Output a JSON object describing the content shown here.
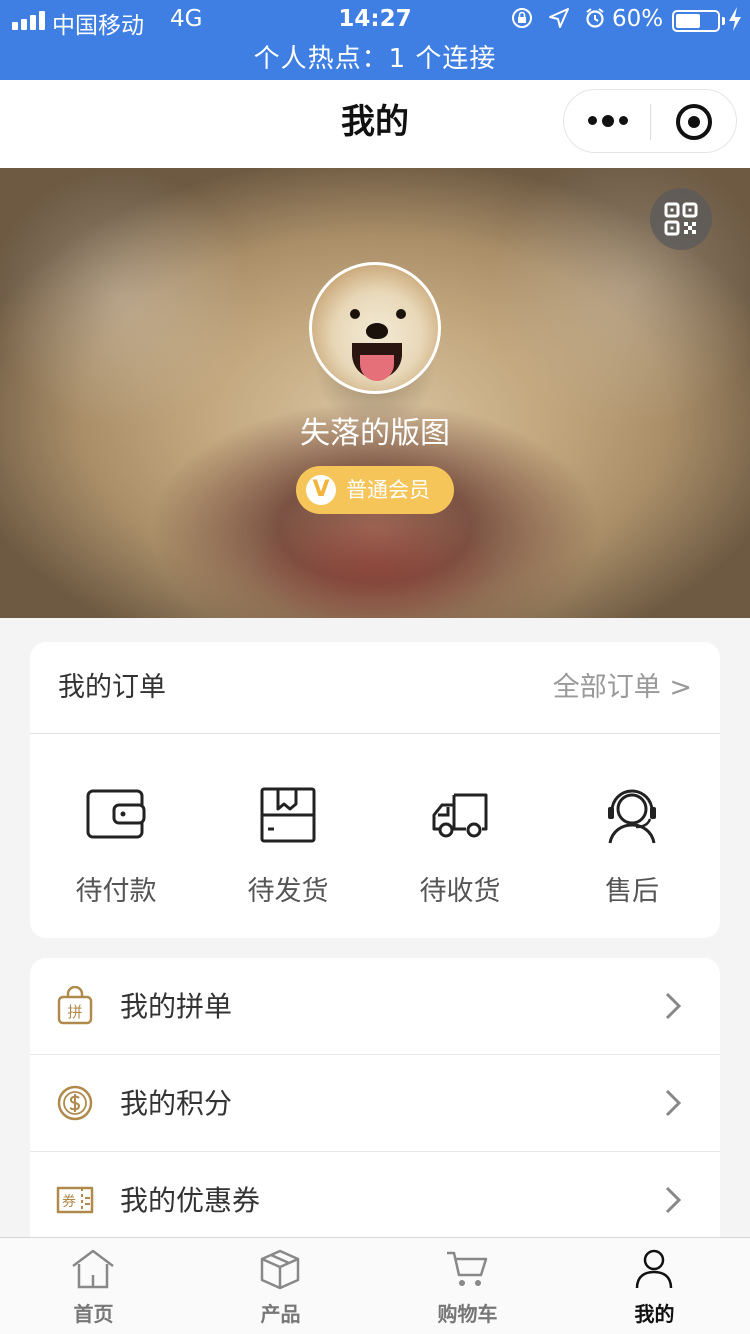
{
  "status_bar": {
    "carrier": "中国移动",
    "network": "4G",
    "time": "14:27",
    "battery_percent": "60%",
    "battery_level": 0.6,
    "hotspot": "个人热点：1 个连接"
  },
  "nav": {
    "title": "我的"
  },
  "profile": {
    "username": "失落的版图",
    "member_badge_letter": "V",
    "member_level": "普通会员"
  },
  "orders": {
    "title": "我的订单",
    "all_link": "全部订单 >",
    "items": [
      {
        "label": "待付款",
        "icon": "wallet-icon"
      },
      {
        "label": "待发货",
        "icon": "package-icon"
      },
      {
        "label": "待收货",
        "icon": "delivery-truck-icon"
      },
      {
        "label": "售后",
        "icon": "customer-service-icon"
      }
    ]
  },
  "menu": {
    "items": [
      {
        "label": "我的拼单",
        "icon": "group-buy-bag-icon",
        "icon_text": "拼"
      },
      {
        "label": "我的积分",
        "icon": "points-coin-icon"
      },
      {
        "label": "我的优惠券",
        "icon": "coupon-icon",
        "icon_text": "券"
      }
    ]
  },
  "tabbar": {
    "items": [
      {
        "label": "首页",
        "icon": "home-icon",
        "active": false
      },
      {
        "label": "产品",
        "icon": "product-box-icon",
        "active": false
      },
      {
        "label": "购物车",
        "icon": "cart-icon",
        "active": false
      },
      {
        "label": "我的",
        "icon": "user-icon",
        "active": true
      }
    ]
  },
  "colors": {
    "status_bar": "#3f7ee3",
    "member_badge": "#f6c55a",
    "menu_icon_gold": "#b08a4c"
  }
}
